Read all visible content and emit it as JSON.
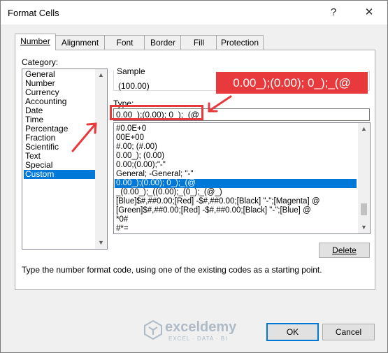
{
  "window": {
    "title": "Format Cells",
    "help_symbol": "?",
    "close_symbol": "✕"
  },
  "tabs": [
    {
      "label": "Number"
    },
    {
      "label": "Alignment"
    },
    {
      "label": "Font"
    },
    {
      "label": "Border"
    },
    {
      "label": "Fill"
    },
    {
      "label": "Protection"
    }
  ],
  "category": {
    "label": "Category:",
    "items": [
      "General",
      "Number",
      "Currency",
      "Accounting",
      "Date",
      "Time",
      "Percentage",
      "Fraction",
      "Scientific",
      "Text",
      "Special",
      "Custom"
    ],
    "selected": "Custom"
  },
  "sample": {
    "label": "Sample",
    "value": "(100.00)"
  },
  "type": {
    "label": "Type:",
    "value": "0.00_);(0.00); 0_);_(@",
    "list": [
      "#0.0E+0",
      "00E+00",
      "#.00; (#.00)",
      "0.00_); (0.00)",
      "0.00;(0.00);\"-\"",
      "General; -General; \"-\"",
      "0.00_);(0.00); 0_);_(@",
      "_(0.00_);_((0.00);_(0_);_(@_)",
      "[Blue]$#,##0.00;[Red] -$#,##0.00;[Black] \"-\";[Magenta] @",
      "[Green]$#,##0.00;[Red] -$#,##0.00;[Black] \"-\";[Blue] @",
      "*0#",
      "#*="
    ],
    "selected": "0.00_);(0.00); 0_);_(@"
  },
  "buttons": {
    "delete": "Delete",
    "ok": "OK",
    "cancel": "Cancel"
  },
  "help_text": "Type the number format code, using one of the existing codes as a starting point.",
  "annotation": {
    "callout_text": "0.00_);(0.00); 0_);_(@",
    "color": "#e8393d"
  },
  "watermark": {
    "name": "exceldemy",
    "tagline": "EXCEL · DATA · BI"
  },
  "colors": {
    "selection": "#0078d7",
    "accent_red": "#e8393d"
  }
}
